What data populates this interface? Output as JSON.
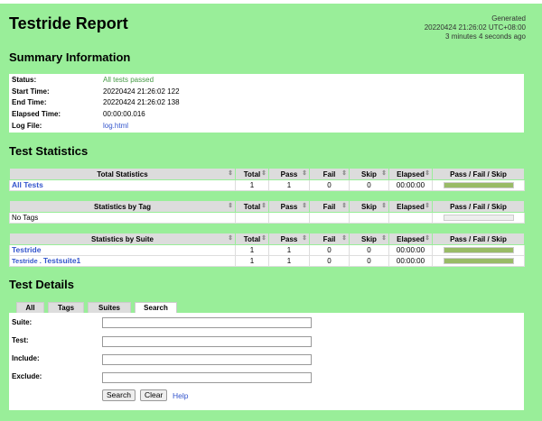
{
  "header": {
    "title": "Testride Report",
    "generated_label": "Generated",
    "generated_time": "20220424 21:26:02 UTC+08:00",
    "generated_ago": "3 minutes 4 seconds ago"
  },
  "summary": {
    "heading": "Summary Information",
    "rows": [
      {
        "label": "Status:",
        "value": "All tests passed"
      },
      {
        "label": "Start Time:",
        "value": "20220424 21:26:02 122"
      },
      {
        "label": "End Time:",
        "value": "20220424 21:26:02 138"
      },
      {
        "label": "Elapsed Time:",
        "value": "00:00:00.016"
      },
      {
        "label": "Log File:",
        "value": "log.html"
      }
    ]
  },
  "statistics": {
    "heading": "Test Statistics",
    "columns": [
      "Total",
      "Pass",
      "Fail",
      "Skip",
      "Elapsed",
      "Pass / Fail / Skip"
    ],
    "sort_icon": "⇕",
    "total": {
      "title": "Total Statistics",
      "rows": [
        {
          "name": "All Tests",
          "total": "1",
          "pass": "1",
          "fail": "0",
          "skip": "0",
          "elapsed": "00:00:00",
          "pass_ratio": 1
        }
      ]
    },
    "tag": {
      "title": "Statistics by Tag",
      "rows": [
        {
          "name": "No Tags",
          "total": "",
          "pass": "",
          "fail": "",
          "skip": "",
          "elapsed": "",
          "pass_ratio": 0
        }
      ]
    },
    "suite": {
      "title": "Statistics by Suite",
      "rows": [
        {
          "name": "Testride",
          "total": "1",
          "pass": "1",
          "fail": "0",
          "skip": "0",
          "elapsed": "00:00:00",
          "pass_ratio": 1
        },
        {
          "name_prefix": "Testride . ",
          "name": "Testsuite1",
          "total": "1",
          "pass": "1",
          "fail": "0",
          "skip": "0",
          "elapsed": "00:00:00",
          "pass_ratio": 1
        }
      ]
    }
  },
  "details": {
    "heading": "Test Details",
    "tabs": [
      "All",
      "Tags",
      "Suites",
      "Search"
    ],
    "active_tab": "Search",
    "fields": [
      {
        "label": "Suite:",
        "value": ""
      },
      {
        "label": "Test:",
        "value": ""
      },
      {
        "label": "Include:",
        "value": ""
      },
      {
        "label": "Exclude:",
        "value": ""
      }
    ],
    "search_button": "Search",
    "clear_button": "Clear",
    "help_link": "Help"
  },
  "colors": {
    "background": "#99ee99",
    "pass_bar": "#99bb66",
    "link": "#3355cc",
    "status_pass": "#449944"
  }
}
